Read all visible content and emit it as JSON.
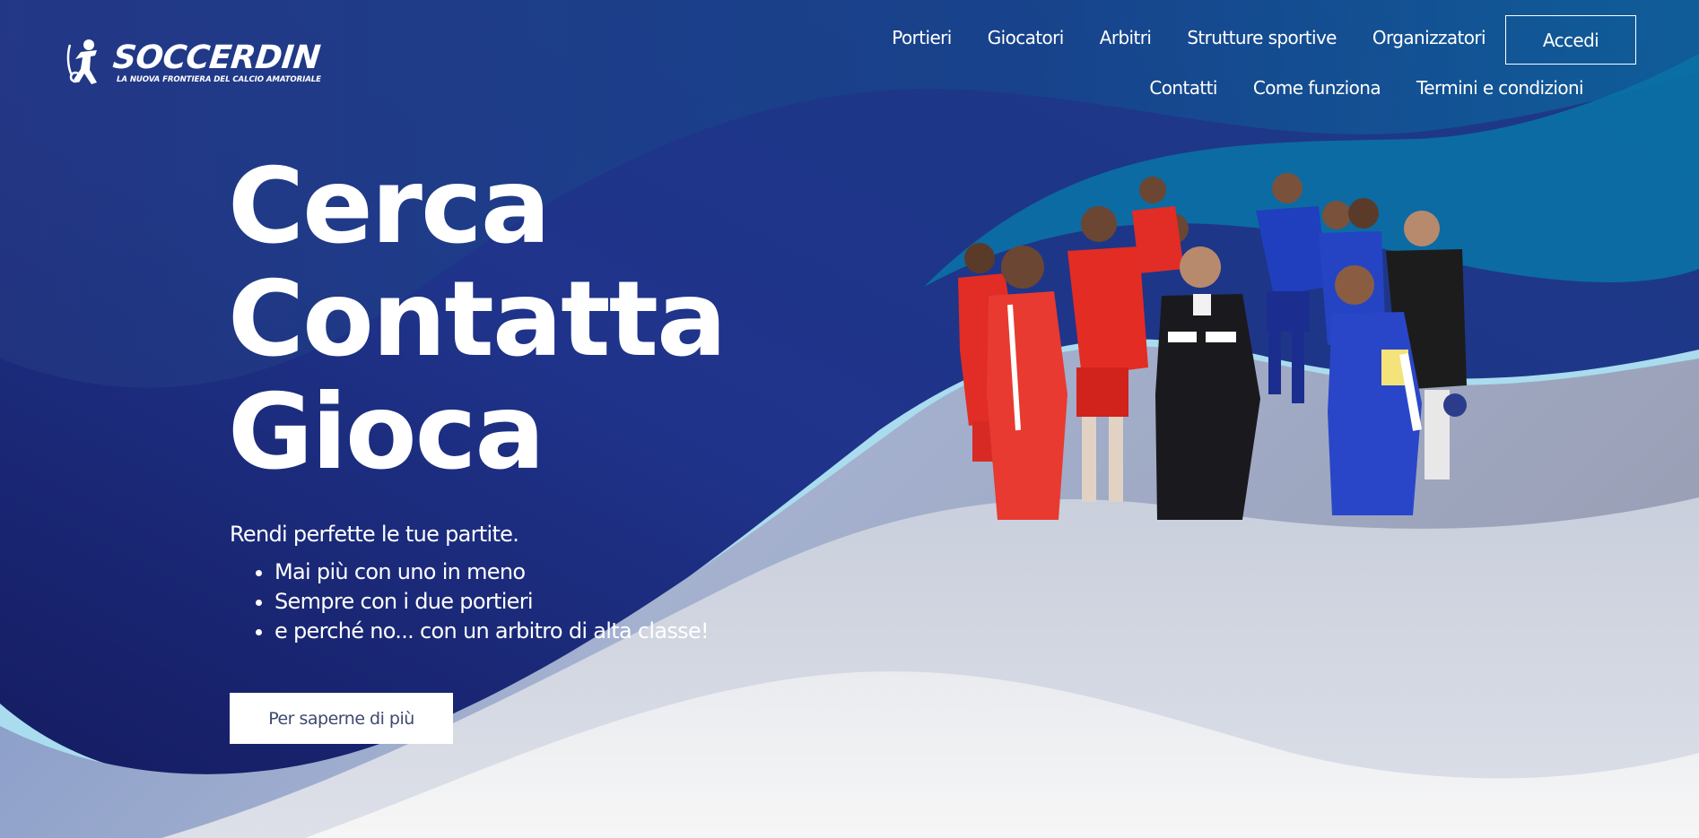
{
  "brand": {
    "name": "SOCCERDIN",
    "tagline": "LA NUOVA FRONTIERA DEL CALCIO AMATORIALE"
  },
  "nav": {
    "primary": [
      "Portieri",
      "Giocatori",
      "Arbitri",
      "Strutture sportive",
      "Organizzatori"
    ],
    "secondary": [
      "Contatti",
      "Come funziona",
      "Termini e condizioni"
    ],
    "login_label": "Accedi"
  },
  "hero": {
    "title_lines": [
      "Cerca",
      "Contatta",
      "Gioca"
    ],
    "intro": "Rendi perfette le tue partite.",
    "bullets": [
      "Mai più con uno in meno",
      "Sempre con i due portieri",
      "e perché no... con un arbitro di alta classe!"
    ],
    "cta_label": "Per saperne di più"
  },
  "colors": {
    "background_dark": "#1d2c7a",
    "wave_teal": "#0b74a8",
    "wave_light": "#eef0f4",
    "text": "#ffffff",
    "button_text": "#3d4a6e"
  }
}
